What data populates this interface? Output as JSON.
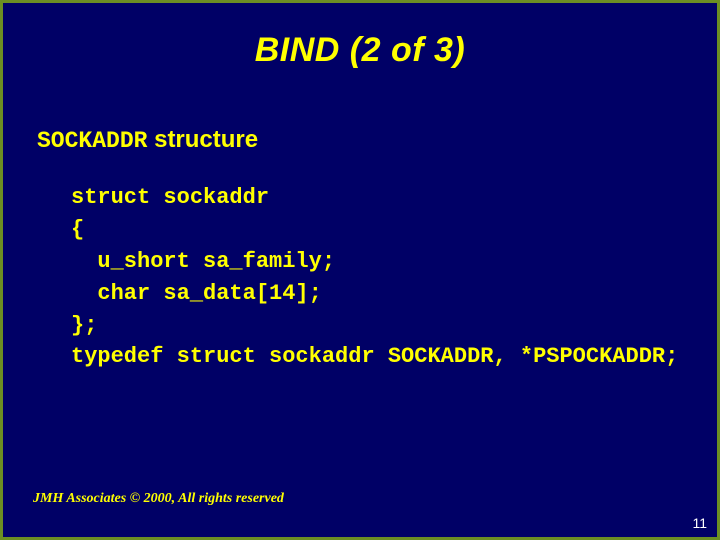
{
  "title": "BIND (2 of 3)",
  "subtitle_kw": "SOCKADDR",
  "subtitle_rest": " structure",
  "code": "struct sockaddr\n{\n  u_short sa_family;\n  char sa_data[14];\n};\ntypedef struct sockaddr SOCKADDR, *PSPOCKADDR;",
  "footer": "JMH Associates © 2000, All rights reserved",
  "pagenum": "11"
}
